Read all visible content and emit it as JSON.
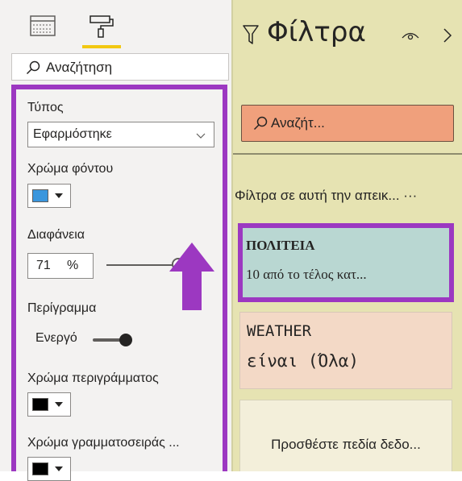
{
  "format_pane": {
    "tabs": [
      {
        "name": "fields-icon",
        "selected": false
      },
      {
        "name": "format-paintroller-icon",
        "selected": true
      }
    ],
    "search_placeholder": "Αναζήτηση",
    "card": {
      "type_label": "Τύπος",
      "type_value": "Εφαρμόστηκε",
      "background_color_label": "Χρώμα φόντου",
      "background_color": "#3a96dd",
      "transparency_label": "Διαφάνεια",
      "transparency_value": "71",
      "transparency_unit": "%",
      "transparency_percent": 71,
      "border_label": "Περίγραμμα",
      "border_toggle_label": "Ενεργό",
      "border_toggle_on": true,
      "border_color_label": "Χρώμα περιγράμματος",
      "border_color": "#000000",
      "font_color_label": "Χρώμα γραμματοσειράς ...",
      "font_color": "#000000"
    }
  },
  "filters_pane": {
    "title": "Φίλτρα",
    "search_placeholder": "Αναζήτ...",
    "section_label": "Φίλτρα σε αυτή την απεικ... ···",
    "cards": [
      {
        "title": "ΠΟΛΙΤΕΙΑ",
        "subtitle": "10 από το τέλος κατ..."
      },
      {
        "title": "WEATHER",
        "subtitle": "είναι (Όλα)"
      }
    ],
    "add_fields": "Προσθέστε πεδία δεδο..."
  },
  "colors": {
    "highlight_purple": "#9c38c1",
    "accent_yellow": "#f2c811",
    "filter_pane_bg": "#e6e3b2",
    "filter_search_bg": "#f0a07c",
    "card_applied_bg": "#b9d7d2",
    "card_weather_bg": "#f3d9c6"
  }
}
